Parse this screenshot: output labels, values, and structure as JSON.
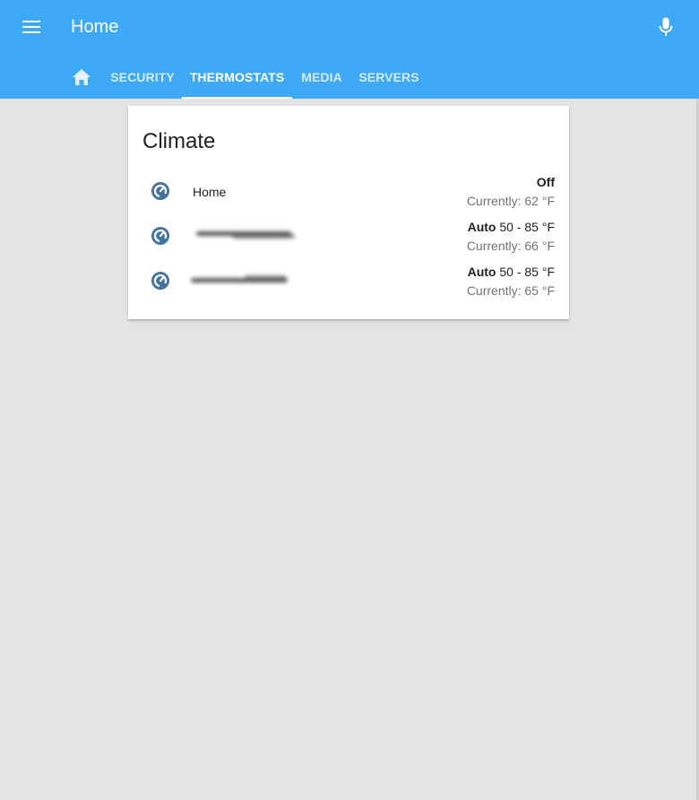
{
  "header": {
    "title": "Home",
    "menu_icon": "menu-icon",
    "mic_icon": "microphone-icon",
    "background_color": "#3ea9f5"
  },
  "tabs": [
    {
      "icon": "home-icon",
      "label": ""
    },
    {
      "label": "SECURITY"
    },
    {
      "label": "THERMOSTATS",
      "active": true
    },
    {
      "label": "MEDIA"
    },
    {
      "label": "SERVERS"
    }
  ],
  "card": {
    "title": "Climate",
    "entities": [
      {
        "name": "Home",
        "icon": "thermostat-icon",
        "mode": "Off",
        "range": "",
        "current": "Currently: 62 °F"
      },
      {
        "name": "",
        "redacted": true,
        "icon": "thermostat-icon",
        "mode": "Auto",
        "range": " 50 - 85 °F",
        "current": "Currently: 66 °F"
      },
      {
        "name": "",
        "redacted": true,
        "icon": "thermostat-icon",
        "mode": "Auto",
        "range": " 50 - 85 °F",
        "current": "Currently: 65 °F"
      }
    ]
  },
  "colors": {
    "accent": "#3ea9f5",
    "icon": "#44739e",
    "page_background": "#e4e4e4"
  }
}
